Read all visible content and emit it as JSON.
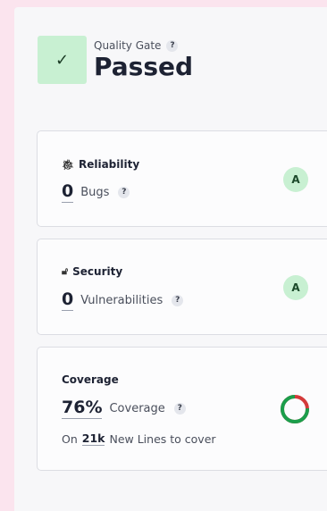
{
  "quality_gate": {
    "label": "Quality Gate",
    "status": "Passed",
    "badge_icon": "check-icon",
    "help_glyph": "?"
  },
  "reliability": {
    "title": "Reliability",
    "icon": "bug-icon",
    "value": "0",
    "metric_label": "Bugs",
    "rating": "A",
    "help_glyph": "?"
  },
  "security": {
    "title": "Security",
    "icon": "lock-icon",
    "value": "0",
    "metric_label": "Vulnerabilities",
    "rating": "A",
    "help_glyph": "?"
  },
  "coverage": {
    "title": "Coverage",
    "value": "76%",
    "metric_label": "Coverage",
    "help_glyph": "?",
    "lines_prefix": "On",
    "lines_value": "21k",
    "lines_suffix": "New Lines to cover",
    "fraction": 0.76
  },
  "colors": {
    "passed_bg": "#c8f0d2",
    "covered": "#1b9e4b",
    "uncovered": "#d43a3a"
  }
}
